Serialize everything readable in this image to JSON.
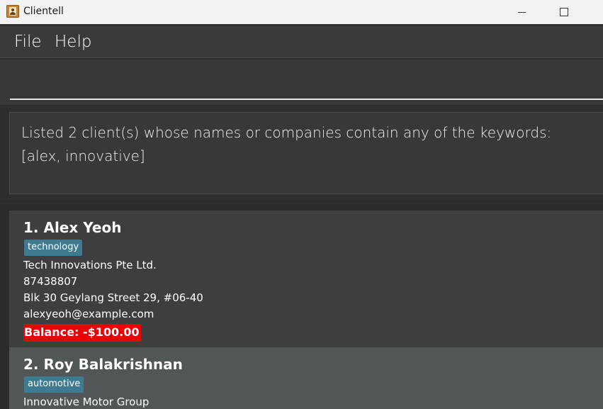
{
  "window": {
    "title": "Clientell",
    "icon": "contact-book-icon"
  },
  "menu": {
    "file": "File",
    "help": "Help"
  },
  "command": {
    "value": ""
  },
  "result": {
    "message": "Listed 2 client(s) whose names or companies contain any of the keywords: [alex, innovative]"
  },
  "clients": [
    {
      "name": "1. Alex Yeoh",
      "tag": "technology",
      "company": "Tech Innovations Pte Ltd.",
      "phone": "87438807",
      "address": "Blk 30 Geylang Street 29, #06-40",
      "email": "alexyeoh@example.com",
      "balance": "Balance: -$100.00"
    },
    {
      "name": "2. Roy Balakrishnan",
      "tag": "automotive",
      "company": "Innovative Motor Group"
    }
  ],
  "colors": {
    "tag": "#3e7b91",
    "balance_negative": "#ea0000",
    "card_default": "#3c3e3f",
    "card_selected": "#515658"
  }
}
